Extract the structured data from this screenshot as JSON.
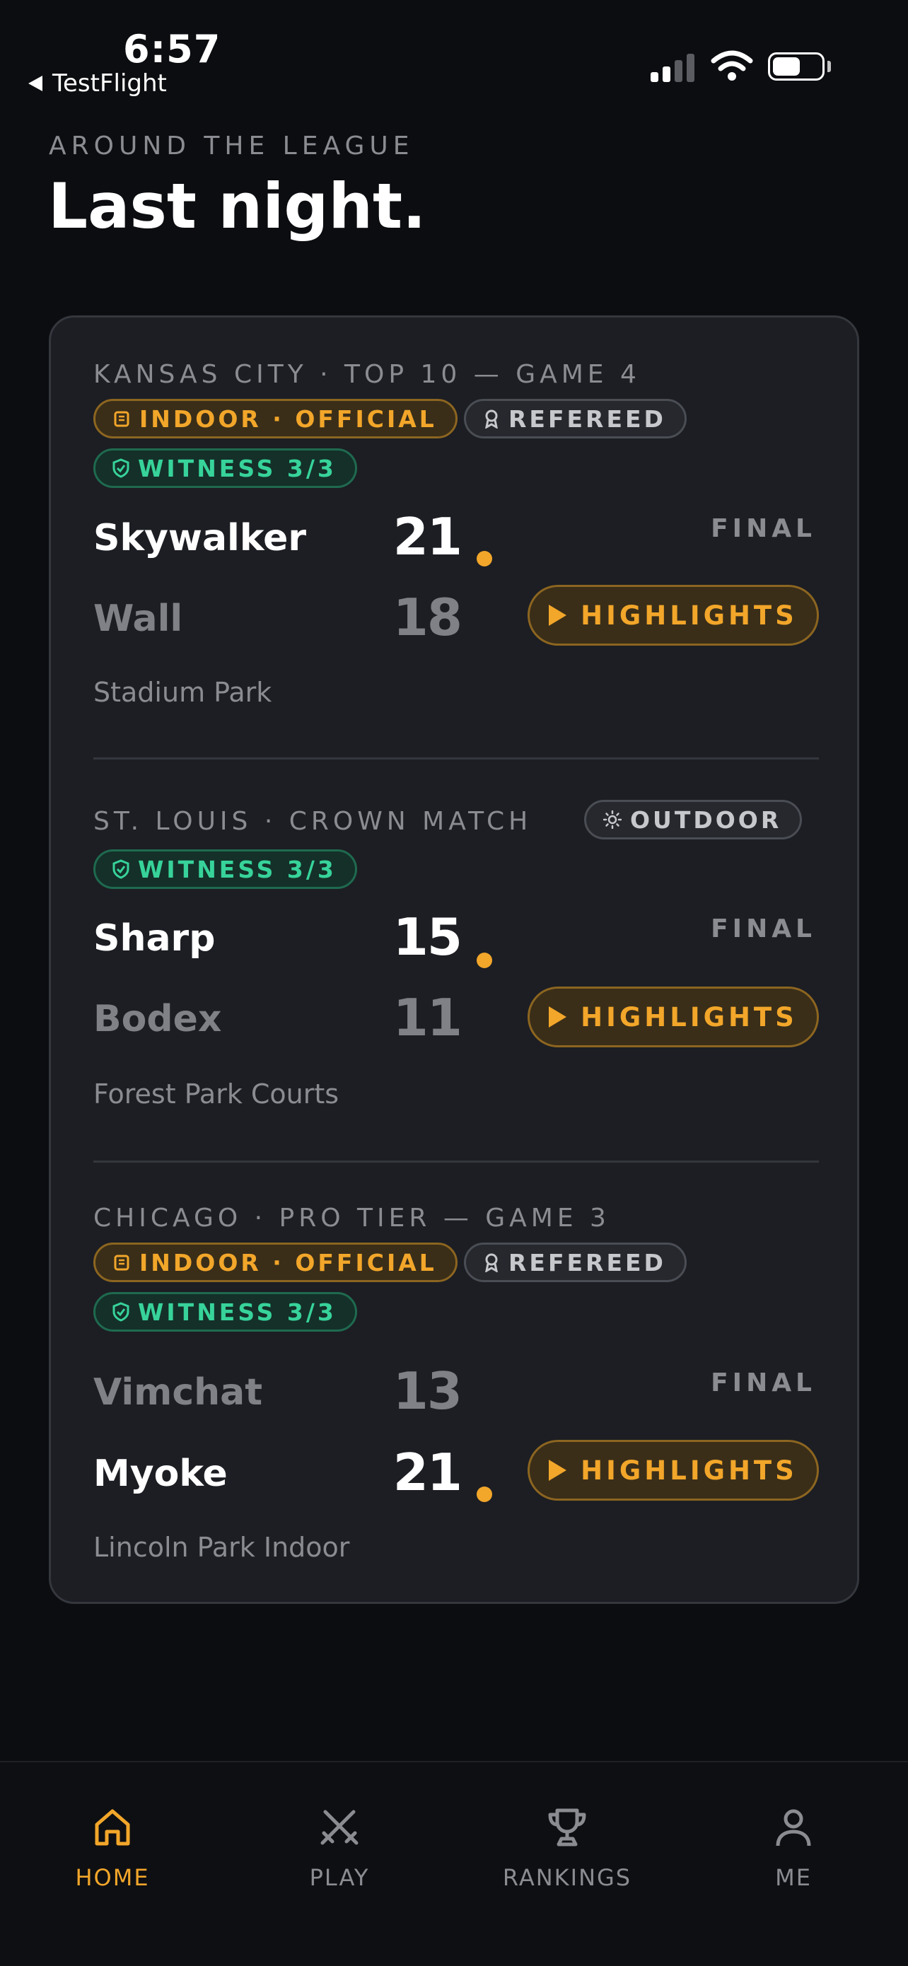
{
  "status_bar": {
    "time": "6:57",
    "back_label": "TestFlight"
  },
  "header": {
    "eyebrow": "AROUND THE LEAGUE",
    "title": "Last night."
  },
  "games": [
    {
      "title": "KANSAS CITY · TOP 10 — GAME 4",
      "badges": {
        "indoor": "INDOOR · OFFICIAL",
        "refereed": "REFEREED",
        "witness": "WITNESS 3/3"
      },
      "team1": {
        "name": "Skywalker",
        "score": "21",
        "winner": true
      },
      "team2": {
        "name": "Wall",
        "score": "18",
        "winner": false
      },
      "status": "FINAL",
      "highlights": "HIGHLIGHTS",
      "venue": "Stadium Park"
    },
    {
      "title": "ST. LOUIS · CROWN MATCH",
      "badges": {
        "outdoor": "OUTDOOR",
        "witness": "WITNESS 3/3"
      },
      "team1": {
        "name": "Sharp",
        "score": "15",
        "winner": true
      },
      "team2": {
        "name": "Bodex",
        "score": "11",
        "winner": false
      },
      "status": "FINAL",
      "highlights": "HIGHLIGHTS",
      "venue": "Forest Park Courts"
    },
    {
      "title": "CHICAGO · PRO TIER — GAME 3",
      "badges": {
        "indoor": "INDOOR · OFFICIAL",
        "refereed": "REFEREED",
        "witness": "WITNESS 3/3"
      },
      "team1": {
        "name": "Vimchat",
        "score": "13",
        "winner": false
      },
      "team2": {
        "name": "Myoke",
        "score": "21",
        "winner": true
      },
      "status": "FINAL",
      "highlights": "HIGHLIGHTS",
      "venue": "Lincoln Park Indoor"
    }
  ],
  "tabbar": {
    "home": "HOME",
    "play": "PLAY",
    "rankings": "RANKINGS",
    "me": "ME",
    "active": "home"
  },
  "colors": {
    "accent": "#f2a62a",
    "witness": "#37d39a",
    "background": "#0c0d10",
    "card": "#1c1e23"
  }
}
